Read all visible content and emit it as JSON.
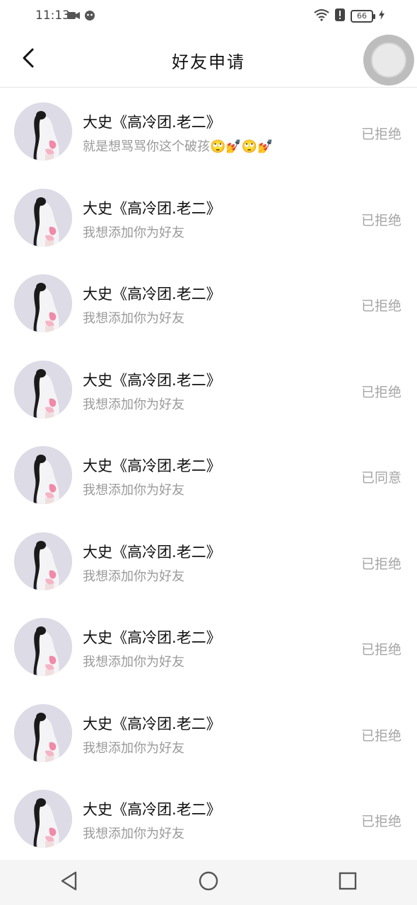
{
  "status_bar": {
    "time": "11:13",
    "battery": "66"
  },
  "header": {
    "title": "好友申请"
  },
  "requests": [
    {
      "name": "大史《高冷团.老二》",
      "message": "就是想骂骂你这个破孩",
      "emojis": "🙄💅🙄💅",
      "status": "已拒绝"
    },
    {
      "name": "大史《高冷团.老二》",
      "message": "我想添加你为好友",
      "emojis": "",
      "status": "已拒绝"
    },
    {
      "name": "大史《高冷团.老二》",
      "message": "我想添加你为好友",
      "emojis": "",
      "status": "已拒绝"
    },
    {
      "name": "大史《高冷团.老二》",
      "message": "我想添加你为好友",
      "emojis": "",
      "status": "已拒绝"
    },
    {
      "name": "大史《高冷团.老二》",
      "message": "我想添加你为好友",
      "emojis": "",
      "status": "已同意"
    },
    {
      "name": "大史《高冷团.老二》",
      "message": "我想添加你为好友",
      "emojis": "",
      "status": "已拒绝"
    },
    {
      "name": "大史《高冷团.老二》",
      "message": "我想添加你为好友",
      "emojis": "",
      "status": "已拒绝"
    },
    {
      "name": "大史《高冷团.老二》",
      "message": "我想添加你为好友",
      "emojis": "",
      "status": "已拒绝"
    },
    {
      "name": "大史《高冷团.老二》",
      "message": "我想添加你为好友",
      "emojis": "",
      "status": "已拒绝"
    }
  ],
  "icons": {
    "back": "chevron-left-icon",
    "nav_back": "triangle-back-icon",
    "nav_home": "circle-home-icon",
    "nav_recents": "square-recents-icon"
  }
}
